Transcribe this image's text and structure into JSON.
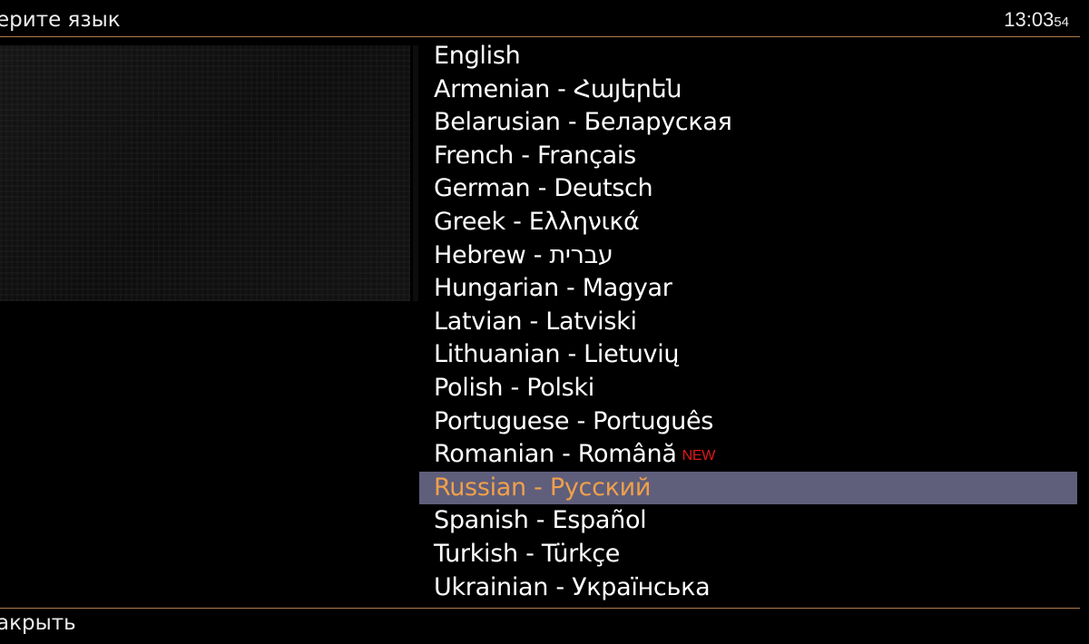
{
  "header": {
    "title": "ерите язык",
    "clock_hm": "13:03",
    "clock_sec": "54"
  },
  "colors": {
    "separator": "#b07a4c",
    "selection_bg": "#5f5e7b",
    "selection_text": "#f0a04b",
    "badge": "#e01818"
  },
  "languages": [
    {
      "label": "English"
    },
    {
      "label": "Armenian - Հայերեն"
    },
    {
      "label": "Belarusian - Беларуская"
    },
    {
      "label": "French - Français"
    },
    {
      "label": "German - Deutsch"
    },
    {
      "label": "Greek - Ελληνικά"
    },
    {
      "label": "Hebrew - עברית"
    },
    {
      "label": "Hungarian - Magyar"
    },
    {
      "label": "Latvian - Latviski"
    },
    {
      "label": "Lithuanian - Lietuvių"
    },
    {
      "label": "Polish - Polski"
    },
    {
      "label": "Portuguese - Português"
    },
    {
      "label": "Romanian - Română",
      "badge": "NEW"
    },
    {
      "label": "Russian - Русский",
      "selected": true
    },
    {
      "label": "Spanish - Español"
    },
    {
      "label": "Turkish - Türkçe"
    },
    {
      "label": "Ukrainian - Українська"
    }
  ],
  "footer": {
    "close_label": "акрыть"
  }
}
